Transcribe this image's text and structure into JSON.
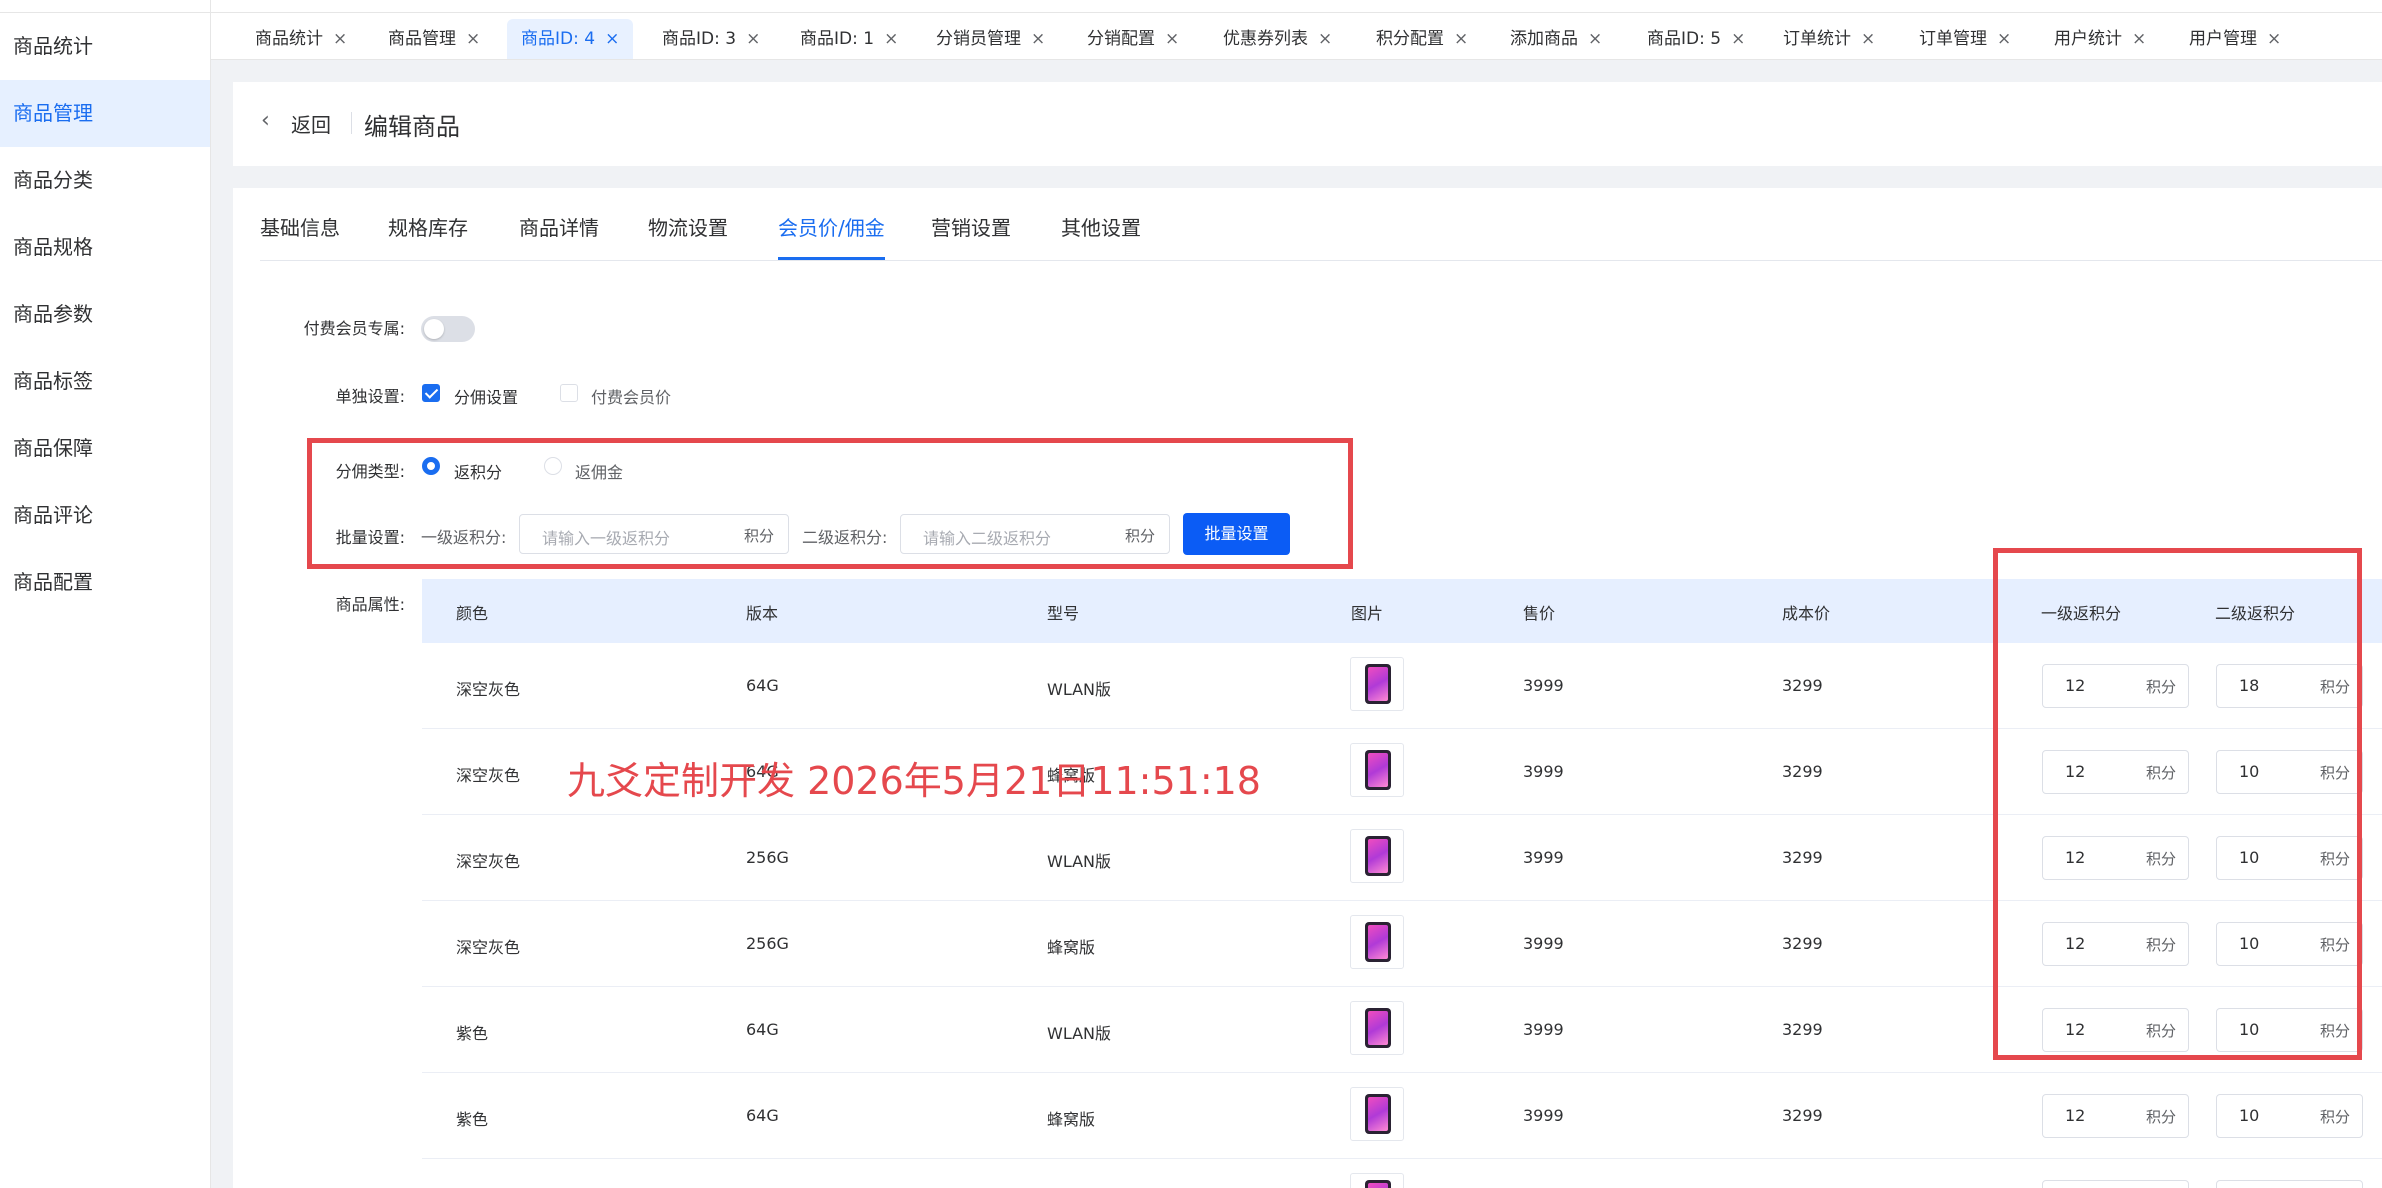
{
  "sidebar": {
    "items": [
      {
        "label": "商品统计"
      },
      {
        "label": "商品管理",
        "active": true
      },
      {
        "label": "商品分类"
      },
      {
        "label": "商品规格"
      },
      {
        "label": "商品参数"
      },
      {
        "label": "商品标签"
      },
      {
        "label": "商品保障"
      },
      {
        "label": "商品评论"
      },
      {
        "label": "商品配置"
      }
    ]
  },
  "tabs": [
    {
      "label": "商品统计"
    },
    {
      "label": "商品管理"
    },
    {
      "label": "商品ID: 4",
      "active": true
    },
    {
      "label": "商品ID: 3"
    },
    {
      "label": "商品ID: 1"
    },
    {
      "label": "分销员管理"
    },
    {
      "label": "分销配置"
    },
    {
      "label": "优惠券列表"
    },
    {
      "label": "积分配置"
    },
    {
      "label": "添加商品"
    },
    {
      "label": "商品ID: 5"
    },
    {
      "label": "订单统计"
    },
    {
      "label": "订单管理"
    },
    {
      "label": "用户统计"
    },
    {
      "label": "用户管理"
    }
  ],
  "tab_close_glyph": "×",
  "header": {
    "back_glyph": "‹",
    "back_label": "返回",
    "title": "编辑商品"
  },
  "sub_tabs": [
    {
      "label": "基础信息"
    },
    {
      "label": "规格库存"
    },
    {
      "label": "商品详情"
    },
    {
      "label": "物流设置"
    },
    {
      "label": "会员价/佣金",
      "active": true
    },
    {
      "label": "营销设置"
    },
    {
      "label": "其他设置"
    }
  ],
  "form": {
    "paid_member_label": "付费会员专属:",
    "paid_member_on": false,
    "single_setting_label": "单独设置:",
    "opt_commission": "分佣设置",
    "opt_commission_checked": true,
    "opt_member_price": "付费会员价",
    "opt_member_price_checked": false,
    "commission_type_label": "分佣类型:",
    "radio_points": "返积分",
    "radio_points_checked": true,
    "radio_cash": "返佣金",
    "radio_cash_checked": false,
    "batch_label": "批量设置:",
    "level1_label": "一级返积分:",
    "level1_placeholder": "请输入一级返积分",
    "level2_label": "二级返积分:",
    "level2_placeholder": "请输入二级返积分",
    "unit": "积分",
    "batch_button": "批量设置",
    "attr_label": "商品属性:"
  },
  "table": {
    "headers": [
      "颜色",
      "版本",
      "型号",
      "图片",
      "售价",
      "成本价",
      "一级返积分",
      "二级返积分"
    ],
    "unit": "积分",
    "rows": [
      {
        "color": "深空灰色",
        "version": "64G",
        "model": "WLAN版",
        "price": "3999",
        "cost": "3299",
        "level1": "12",
        "level2": "18"
      },
      {
        "color": "深空灰色",
        "version": "64G",
        "model": "蜂窝版",
        "price": "3999",
        "cost": "3299",
        "level1": "12",
        "level2": "10"
      },
      {
        "color": "深空灰色",
        "version": "256G",
        "model": "WLAN版",
        "price": "3999",
        "cost": "3299",
        "level1": "12",
        "level2": "10"
      },
      {
        "color": "深空灰色",
        "version": "256G",
        "model": "蜂窝版",
        "price": "3999",
        "cost": "3299",
        "level1": "12",
        "level2": "10"
      },
      {
        "color": "紫色",
        "version": "64G",
        "model": "WLAN版",
        "price": "3999",
        "cost": "3299",
        "level1": "12",
        "level2": "10"
      },
      {
        "color": "紫色",
        "version": "64G",
        "model": "蜂窝版",
        "price": "3999",
        "cost": "3299",
        "level1": "12",
        "level2": "10"
      }
    ]
  },
  "watermark": "九爻定制开发    2026年5月21日11:51:18",
  "colors": {
    "accent": "#1a6df0",
    "primary_button": "#0b5cf5",
    "highlight_box": "#e5484d",
    "table_header_bg": "#e6efff"
  }
}
